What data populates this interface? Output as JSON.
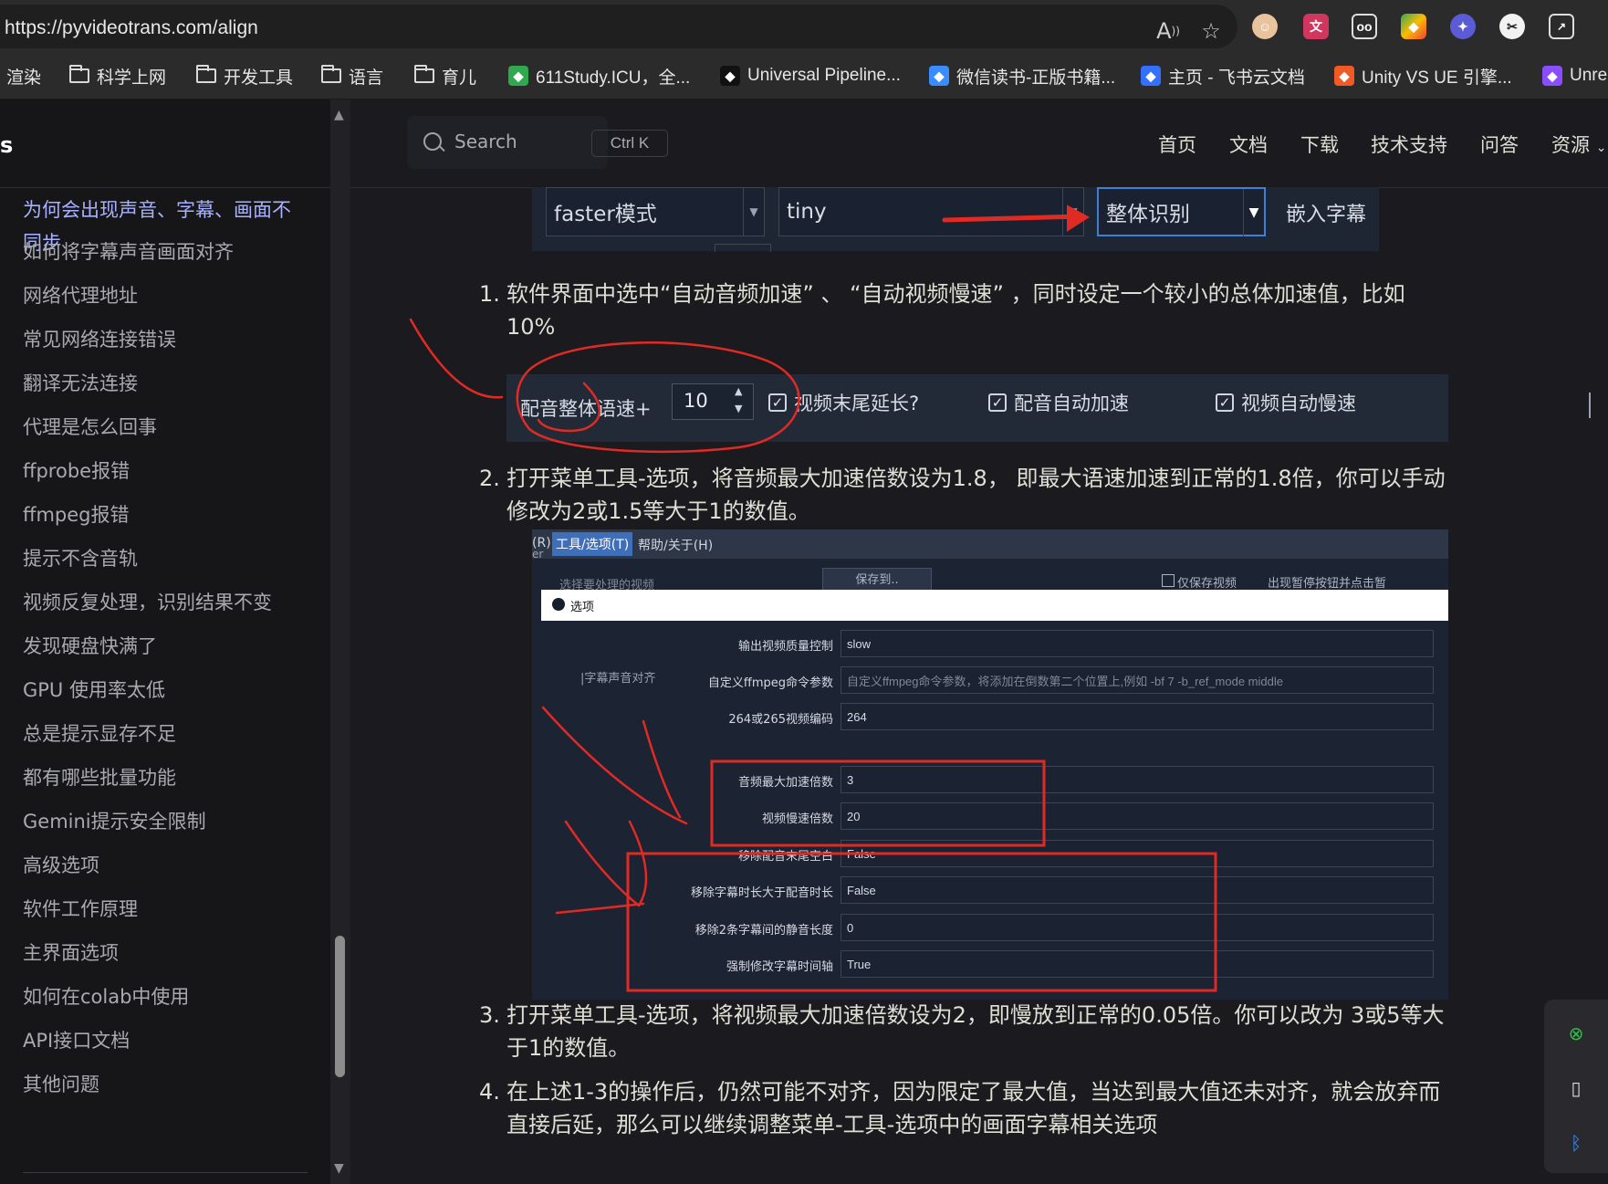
{
  "browser": {
    "url": "https://pyvideotrans.com/align",
    "bookmarks": [
      {
        "label": "渲染",
        "kind": "text"
      },
      {
        "label": "科学上网",
        "kind": "folder"
      },
      {
        "label": "开发工具",
        "kind": "folder"
      },
      {
        "label": "语言",
        "kind": "folder"
      },
      {
        "label": "育儿",
        "kind": "folder"
      },
      {
        "label": "611Study.ICU，全...",
        "kind": "site",
        "color": "#2fa84f"
      },
      {
        "label": "Universal Pipeline...",
        "kind": "site",
        "color": "#111111"
      },
      {
        "label": "微信读书-正版书籍...",
        "kind": "site",
        "color": "#3a8dff"
      },
      {
        "label": "主页 - 飞书云文档",
        "kind": "site",
        "color": "#3370ff"
      },
      {
        "label": "Unity VS UE 引擎...",
        "kind": "site",
        "color": "#f15a24"
      },
      {
        "label": "Unre",
        "kind": "site",
        "color": "#8a4dff"
      }
    ]
  },
  "sidebar": {
    "title": "s",
    "items": [
      {
        "label": "为何会出现声音、字幕、画面不同步",
        "active": true
      },
      {
        "label": "如何将字幕声音画面对齐"
      },
      {
        "label": "网络代理地址"
      },
      {
        "label": "常见网络连接错误"
      },
      {
        "label": "翻译无法连接"
      },
      {
        "label": "代理是怎么回事"
      },
      {
        "label": "ffprobe报错"
      },
      {
        "label": "ffmpeg报错"
      },
      {
        "label": "提示不含音轨"
      },
      {
        "label": "视频反复处理，识别结果不变"
      },
      {
        "label": "发现硬盘快满了"
      },
      {
        "label": "GPU 使用率太低"
      },
      {
        "label": "总是提示显存不足"
      },
      {
        "label": "都有哪些批量功能"
      },
      {
        "label": "Gemini提示安全限制"
      },
      {
        "label": "高级选项"
      },
      {
        "label": "软件工作原理"
      },
      {
        "label": "主界面选项"
      },
      {
        "label": "如何在colab中使用"
      },
      {
        "label": "API接口文档"
      },
      {
        "label": "其他问题"
      }
    ]
  },
  "topnav": {
    "search_label": "Search",
    "search_shortcut": "Ctrl K",
    "links": [
      "首页",
      "文档",
      "下载",
      "技术支持",
      "问答",
      "资源"
    ]
  },
  "screenshot_a": {
    "mode": "faster模式",
    "model": "tiny",
    "recognition": "整体识别",
    "embed": "嵌入字幕"
  },
  "steps": [
    {
      "num": "1.",
      "text": "软件界面中选中“自动音频加速” 、 “自动视频慢速” ，同时设定一个较小的总体加速值，比如 10%"
    },
    {
      "num": "2.",
      "text": "打开菜单工具-选项，将音频最大加速倍数设为1.8， 即最大语速加速到正常的1.8倍，你可以手动修改为2或1.5等大于1的数值。"
    },
    {
      "num": "3.",
      "text": "打开菜单工具-选项，将视频最大加速倍数设为2，即慢放到正常的0.05倍。你可以改为 3或5等大于1的数值。"
    },
    {
      "num": "4.",
      "text": "在上述1-3的操作后，仍然可能不对齐，因为限定了最大值，当达到最大值还未对齐，就会放弃而直接后延，那么可以继续调整菜单-工具-选项中的画面字幕相关选项"
    }
  ],
  "screenshot_b": {
    "speed_label": "配音整体语速+",
    "speed_value": "10",
    "checkboxes": [
      {
        "label": "视频末尾延长?",
        "checked": true
      },
      {
        "label": "配音自动加速",
        "checked": true
      },
      {
        "label": "视频自动慢速",
        "checked": true
      }
    ]
  },
  "screenshot_c": {
    "menu_prefix": "(R)",
    "menu_tools": "工具/选项(T)",
    "menu_help": "帮助/关于(H)",
    "bg_select": "选择要处理的视频",
    "bg_save": "保存到..",
    "bg_only_save": "仅保存视频",
    "bg_pause": "出现暂停按钮并点击暂",
    "bg_side_label": "|字幕声音对齐",
    "dialog_title": "选项",
    "rows": [
      {
        "label": "输出视频质量控制",
        "value": "slow",
        "placeholder": false
      },
      {
        "label": "自定义ffmpeg命令参数",
        "value": "自定义ffmpeg命令参数，将添加在倒数第二个位置上,例如  -bf 7 -b_ref_mode middle",
        "placeholder": true
      },
      {
        "label": "264或265视频编码",
        "value": "264",
        "placeholder": false
      },
      {
        "label": "音频最大加速倍数",
        "value": "3",
        "placeholder": false
      },
      {
        "label": "视频慢速倍数",
        "value": "20",
        "placeholder": false
      },
      {
        "label": "移除配音末尾空白",
        "value": "False",
        "placeholder": false
      },
      {
        "label": "移除字幕时长大于配音时长",
        "value": "False",
        "placeholder": false
      },
      {
        "label": "移除2条字幕间的静音长度",
        "value": "0",
        "placeholder": false
      },
      {
        "label": "强制修改字幕时间轴",
        "value": "True",
        "placeholder": false
      }
    ]
  },
  "colors": {
    "accent": "#a8b1ff",
    "annotation_red": "#e02a24",
    "text": "#dfdfd6"
  }
}
